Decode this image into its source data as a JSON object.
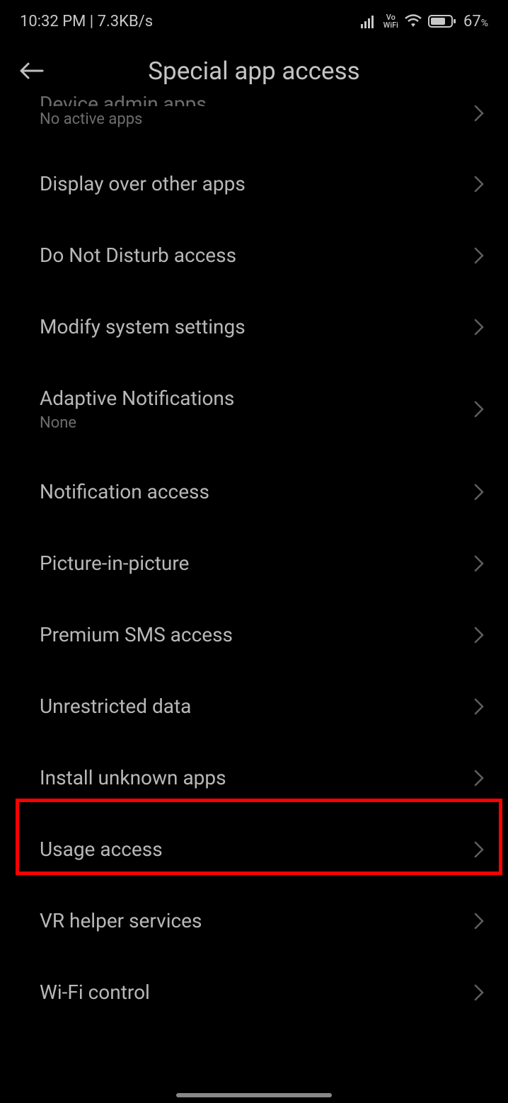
{
  "status": {
    "time": "10:32 PM",
    "speed": "7.3KB/s",
    "vo_wifi_top": "Vo",
    "vo_wifi_bottom": "WiFi",
    "battery_pct": "67",
    "battery_sign": "%"
  },
  "header": {
    "title": "Special app access"
  },
  "items": [
    {
      "label": "Device admin apps",
      "sublabel": "No active apps",
      "partial": true
    },
    {
      "label": "Display over other apps"
    },
    {
      "label": "Do Not Disturb access"
    },
    {
      "label": "Modify system settings"
    },
    {
      "label": "Adaptive Notifications",
      "sublabel": "None"
    },
    {
      "label": "Notification access"
    },
    {
      "label": "Picture-in-picture"
    },
    {
      "label": "Premium SMS access"
    },
    {
      "label": "Unrestricted data"
    },
    {
      "label": "Install unknown apps",
      "highlighted": true
    },
    {
      "label": "Usage access"
    },
    {
      "label": "VR helper services"
    },
    {
      "label": "Wi-Fi control"
    }
  ]
}
